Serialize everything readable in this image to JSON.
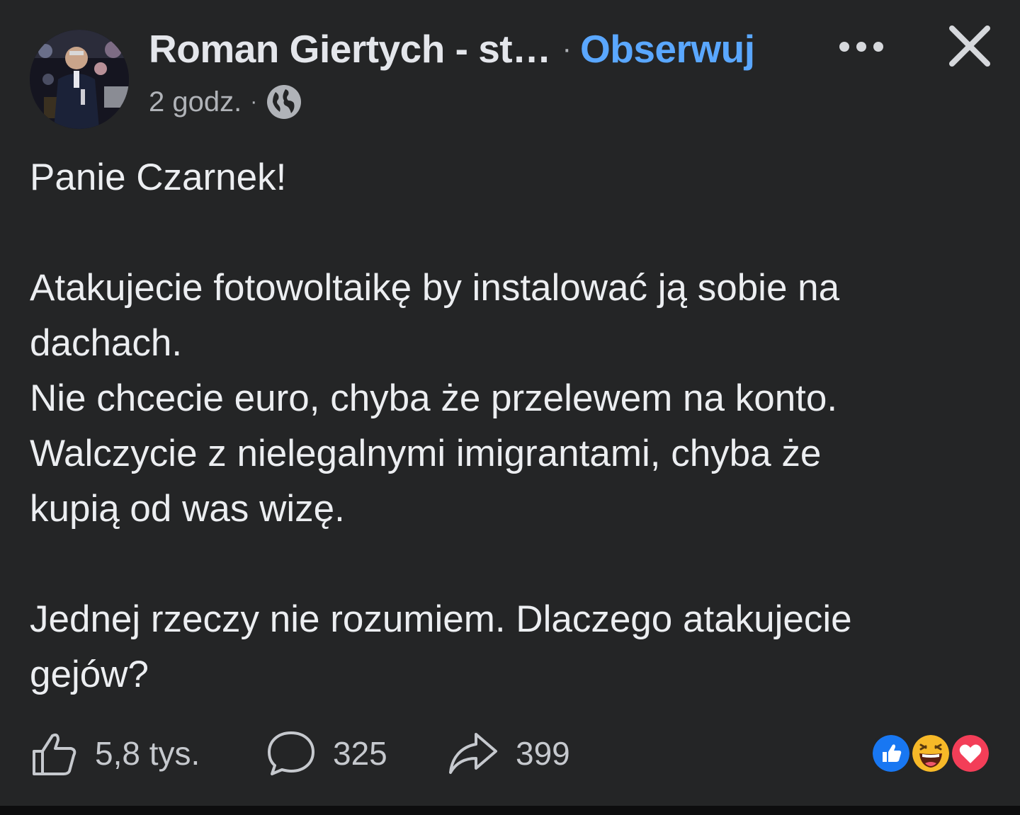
{
  "header": {
    "author_name": "Roman Giertych - st…",
    "separator": "·",
    "follow_label": "Obserwuj",
    "time": "2 godz.",
    "meta_separator": "·",
    "audience_icon": "globe-icon",
    "more_icon": "more-dots-icon",
    "close_icon": "close-icon"
  },
  "post": {
    "lines": {
      "l1": "Panie Czarnek!",
      "l2": "Atakujecie fotowoltaikę by instalować ją sobie na",
      "l3": "dachach.",
      "l4": "Nie chcecie euro, chyba że przelewem na konto.",
      "l5": "Walczycie z nielegalnymi imigrantami, chyba że",
      "l6": "kupią od was wizę.",
      "l7": "Jednej rzeczy nie rozumiem. Dlaczego atakujecie",
      "l8": "gejów?"
    }
  },
  "footer": {
    "likes": "5,8 tys.",
    "comments": "325",
    "shares": "399",
    "reactions": [
      "like",
      "haha",
      "love"
    ]
  },
  "colors": {
    "background": "#242526",
    "text": "#e4e6eb",
    "secondary": "#b0b3b8",
    "link": "#5aa7ff",
    "like_blue": "#1877f2",
    "haha_yellow": "#f7b928",
    "love_red": "#f33e58"
  }
}
